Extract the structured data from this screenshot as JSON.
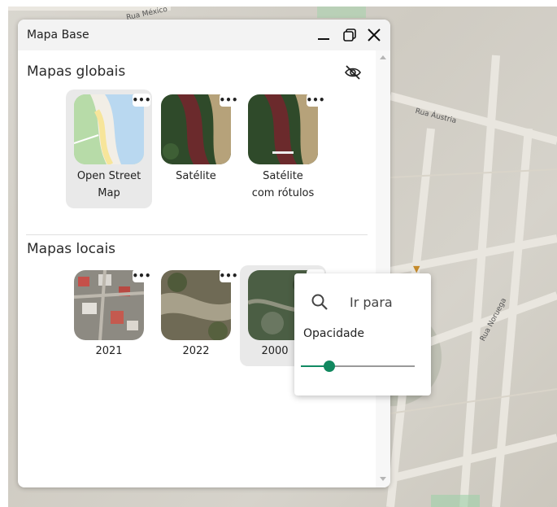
{
  "map": {
    "street_labels": [
      "Rua México",
      "Rua Áustria",
      "Rua Noruega"
    ]
  },
  "panel": {
    "title": "Mapa Base",
    "window_icons": [
      "minimize-icon",
      "restore-icon",
      "close-icon"
    ]
  },
  "global_maps": {
    "heading": "Mapas globais",
    "toggle_icon": "eye-off-icon",
    "items": [
      {
        "label_line1": "Open Street",
        "label_line2": "Map",
        "selected": true
      },
      {
        "label_line1": "Satélite",
        "label_line2": "",
        "selected": false
      },
      {
        "label_line1": "Satélite",
        "label_line2": "com rótulos",
        "selected": false
      }
    ]
  },
  "local_maps": {
    "heading": "Mapas locais",
    "items": [
      {
        "label": "2021",
        "selected": false
      },
      {
        "label": "2022",
        "selected": false
      },
      {
        "label": "2000",
        "selected": true
      }
    ]
  },
  "menu": {
    "more_glyph": "•••",
    "goto_label": "Ir para",
    "opacity_label": "Opacidade",
    "opacity_value": 0.25
  },
  "colors": {
    "accent": "#11885f",
    "titlebar": "#f3f3f3",
    "selected_tile": "#e9e9e9"
  }
}
